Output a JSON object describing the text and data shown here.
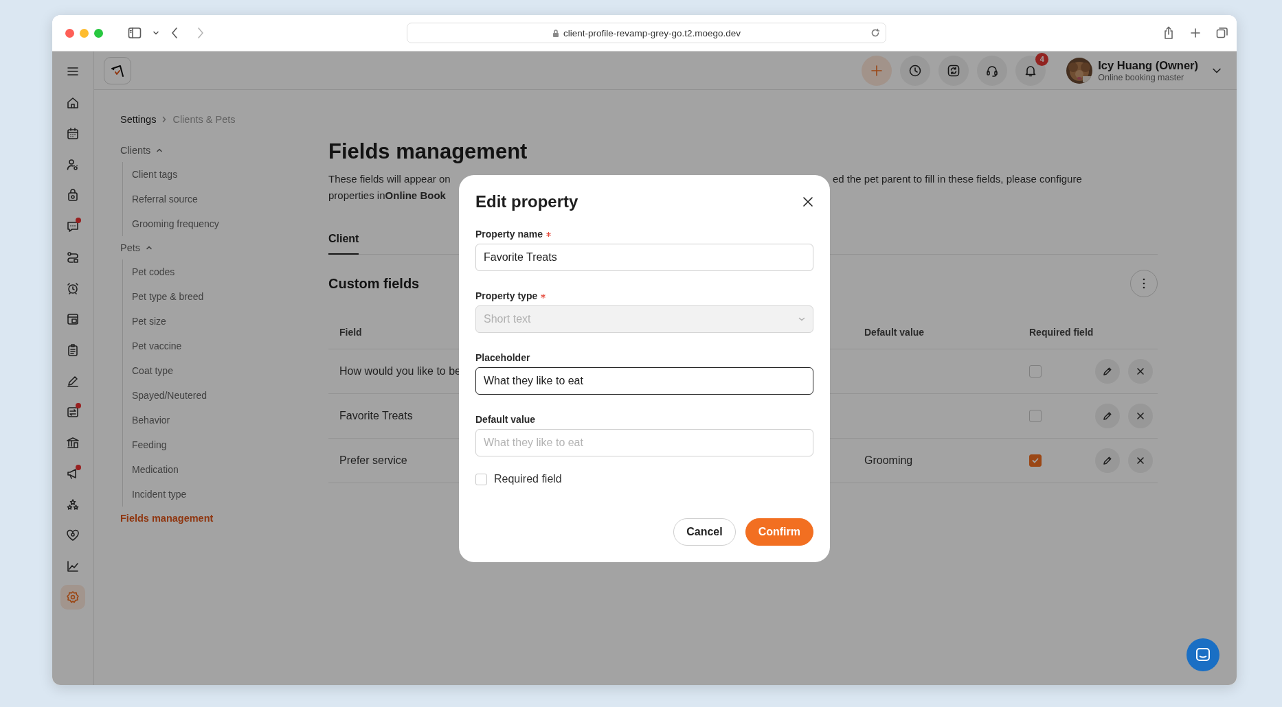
{
  "browser": {
    "url": "client-profile-revamp-grey-go.t2.moego.dev"
  },
  "header": {
    "actions": [
      {
        "kind": "add"
      },
      {
        "kind": "clock"
      },
      {
        "kind": "sync"
      },
      {
        "kind": "support"
      },
      {
        "kind": "bell",
        "badge": "4"
      }
    ],
    "user": {
      "name": "Icy Huang (Owner)",
      "role": "Online booking master"
    }
  },
  "nav": [
    {
      "kind": "home",
      "dot": false,
      "selected": false
    },
    {
      "kind": "calendar",
      "dot": false,
      "selected": false
    },
    {
      "kind": "clients",
      "dot": false,
      "selected": false
    },
    {
      "kind": "bag",
      "dot": false,
      "selected": false
    },
    {
      "kind": "message",
      "dot": true,
      "selected": false
    },
    {
      "kind": "route",
      "dot": false,
      "selected": false
    },
    {
      "kind": "alarm",
      "dot": false,
      "selected": false
    },
    {
      "kind": "store",
      "dot": false,
      "selected": false
    },
    {
      "kind": "clipboard",
      "dot": false,
      "selected": false
    },
    {
      "kind": "pen",
      "dot": false,
      "selected": false
    },
    {
      "kind": "transfer",
      "dot": true,
      "selected": false
    },
    {
      "kind": "bank",
      "dot": false,
      "selected": false
    },
    {
      "kind": "megaphone",
      "dot": true,
      "selected": false
    },
    {
      "kind": "stars",
      "dot": false,
      "selected": false
    },
    {
      "kind": "heart",
      "dot": false,
      "selected": false
    },
    {
      "kind": "chart",
      "dot": false,
      "selected": false
    },
    {
      "kind": "settings",
      "dot": false,
      "selected": true
    }
  ],
  "breadcrumb": [
    "Settings",
    "Clients & Pets"
  ],
  "settings_menu": [
    {
      "kind": "group",
      "label": "Clients",
      "expanded": true,
      "children": [
        {
          "label": "Client tags",
          "selected": false
        },
        {
          "label": "Referral source",
          "selected": false
        },
        {
          "label": "Grooming frequency",
          "selected": false
        }
      ]
    },
    {
      "kind": "group",
      "label": "Pets",
      "expanded": true,
      "children": [
        {
          "label": "Pet codes",
          "selected": false
        },
        {
          "label": "Pet type & breed",
          "selected": false
        },
        {
          "label": "Pet size",
          "selected": false
        },
        {
          "label": "Pet vaccine",
          "selected": false
        },
        {
          "label": "Coat type",
          "selected": false
        },
        {
          "label": "Spayed/Neutered",
          "selected": false
        },
        {
          "label": "Behavior",
          "selected": false
        },
        {
          "label": "Feeding",
          "selected": false
        },
        {
          "label": "Medication",
          "selected": false
        },
        {
          "label": "Incident type",
          "selected": false
        }
      ]
    },
    {
      "kind": "item",
      "label": "Fields management",
      "selected": true
    }
  ],
  "page": {
    "title": "Fields management",
    "description": {
      "line1_left": "These fields will appear on",
      "line1_right": "ed the pet parent to fill in these fields, please configure",
      "line2": "properties in**Online Book**"
    },
    "tabs": [
      {
        "label": "Client",
        "selected": true
      }
    ],
    "custom_fields": {
      "title": "Custom fields",
      "columns": [
        "Field",
        "Default value",
        "Required field"
      ],
      "rows": [
        {
          "field": "How would you like to be",
          "required": false
        },
        {
          "field": "Favorite Treats",
          "required": false
        },
        {
          "field": "Prefer service",
          "default_value": "Grooming",
          "required": true
        }
      ]
    }
  },
  "dialog": {
    "title": "Edit property",
    "fields": [
      {
        "kind": "input",
        "label": "Property name",
        "required": true,
        "value": "Favorite Treats",
        "focused": false
      },
      {
        "kind": "select",
        "label": "Property type",
        "required": true,
        "value": "Short text",
        "disabled": true
      },
      {
        "kind": "input",
        "label": "Placeholder",
        "required": false,
        "value": "What they like to eat",
        "focused": true
      },
      {
        "kind": "input",
        "label": "Default value",
        "required": false,
        "placeholder": "What they like to eat",
        "focused": false
      }
    ],
    "required_field": {
      "label": "Required field",
      "checked": false
    },
    "buttons": [
      {
        "kind": "secondary",
        "label": "Cancel"
      },
      {
        "kind": "primary",
        "label": "Confirm"
      }
    ]
  }
}
